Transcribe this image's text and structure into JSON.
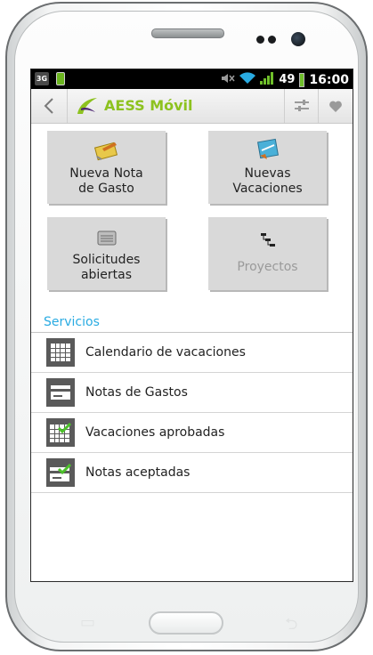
{
  "status_bar": {
    "network": "3G",
    "battery": "49",
    "time": "16:00"
  },
  "header": {
    "title": "AESS Móvil",
    "brand_color": "#8dc21f"
  },
  "tiles": [
    {
      "line1": "Nueva Nota",
      "line2": "de Gasto",
      "icon": "expense-note-icon",
      "enabled": true
    },
    {
      "line1": "Nuevas",
      "line2": "Vacaciones",
      "icon": "vacation-icon",
      "enabled": true
    },
    {
      "line1": "Solicitudes",
      "line2": "abiertas",
      "icon": "open-requests-icon",
      "enabled": true
    },
    {
      "line1": "Proyectos",
      "line2": "",
      "icon": "projects-icon",
      "enabled": false
    }
  ],
  "services": {
    "title": "Servicios",
    "title_color": "#29abe2",
    "items": [
      {
        "label": "Calendario de vacaciones",
        "icon": "calendar-icon"
      },
      {
        "label": "Notas de Gastos",
        "icon": "card-icon"
      },
      {
        "label": "Vacaciones aprobadas",
        "icon": "calendar-check-icon"
      },
      {
        "label": "Notas aceptadas",
        "icon": "card-check-icon"
      }
    ]
  }
}
